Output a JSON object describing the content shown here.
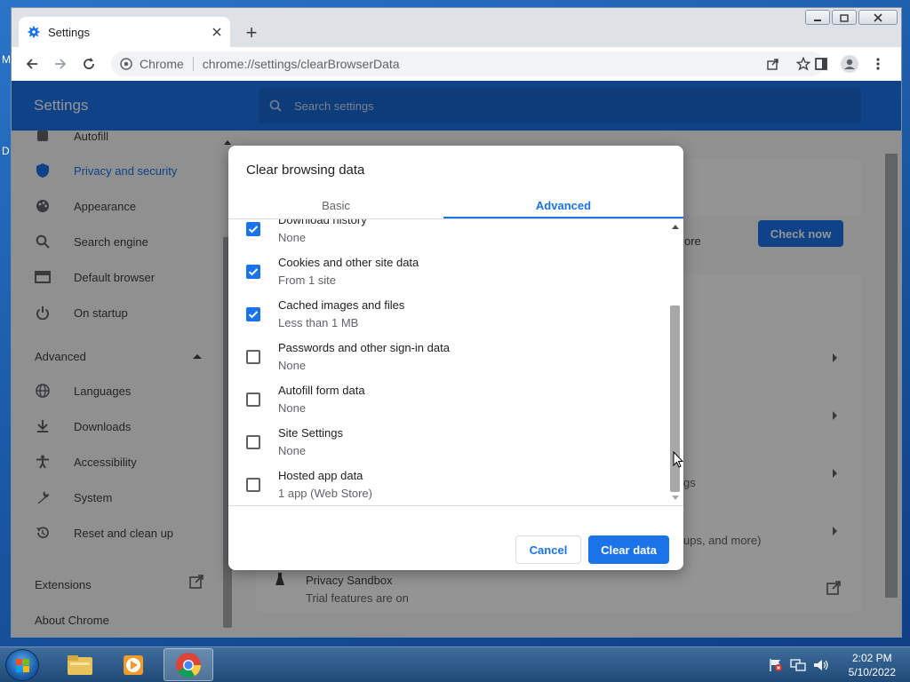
{
  "desktop": {
    "label_m": "M",
    "label_d": "D"
  },
  "browser": {
    "tab_title": "Settings",
    "new_tab_symbol": "+",
    "omnibox_site": "Chrome",
    "omnibox_url": "chrome://settings/clearBrowserData"
  },
  "settings": {
    "header_title": "Settings",
    "search_placeholder": "Search settings",
    "sidebar": {
      "items_top": [
        {
          "label": "Autofill",
          "icon": "autofill-icon"
        },
        {
          "label": "Privacy and security",
          "icon": "shield-icon"
        },
        {
          "label": "Appearance",
          "icon": "palette-icon"
        },
        {
          "label": "Search engine",
          "icon": "search-icon"
        },
        {
          "label": "Default browser",
          "icon": "browser-window-icon"
        },
        {
          "label": "On startup",
          "icon": "power-icon"
        }
      ],
      "advanced_label": "Advanced",
      "items_advanced": [
        {
          "label": "Languages",
          "icon": "globe-icon"
        },
        {
          "label": "Downloads",
          "icon": "download-icon"
        },
        {
          "label": "Accessibility",
          "icon": "accessibility-icon"
        },
        {
          "label": "System",
          "icon": "wrench-icon"
        },
        {
          "label": "Reset and clean up",
          "icon": "reset-icon"
        }
      ],
      "extensions_label": "Extensions",
      "about_label": "About Chrome"
    },
    "background": {
      "check_now": "Check now",
      "frag_more": "ore",
      "frag_gs": "gs",
      "frag_ups": "ups, and more)",
      "sandbox_title": "Privacy Sandbox",
      "sandbox_sub": "Trial features are on"
    }
  },
  "dialog": {
    "title": "Clear browsing data",
    "tabs": {
      "basic": "Basic",
      "advanced": "Advanced"
    },
    "options": [
      {
        "label": "Download history",
        "sub": "None",
        "checked": true
      },
      {
        "label": "Cookies and other site data",
        "sub": "From 1 site",
        "checked": true
      },
      {
        "label": "Cached images and files",
        "sub": "Less than 1 MB",
        "checked": true
      },
      {
        "label": "Passwords and other sign-in data",
        "sub": "None",
        "checked": false
      },
      {
        "label": "Autofill form data",
        "sub": "None",
        "checked": false
      },
      {
        "label": "Site Settings",
        "sub": "None",
        "checked": false
      },
      {
        "label": "Hosted app data",
        "sub": "1 app (Web Store)",
        "checked": false
      }
    ],
    "cancel": "Cancel",
    "clear": "Clear data"
  },
  "taskbar": {
    "time": "2:02 PM",
    "date": "5/10/2022"
  },
  "colors": {
    "accent": "#1a73e8",
    "header": "#1a73e8"
  }
}
